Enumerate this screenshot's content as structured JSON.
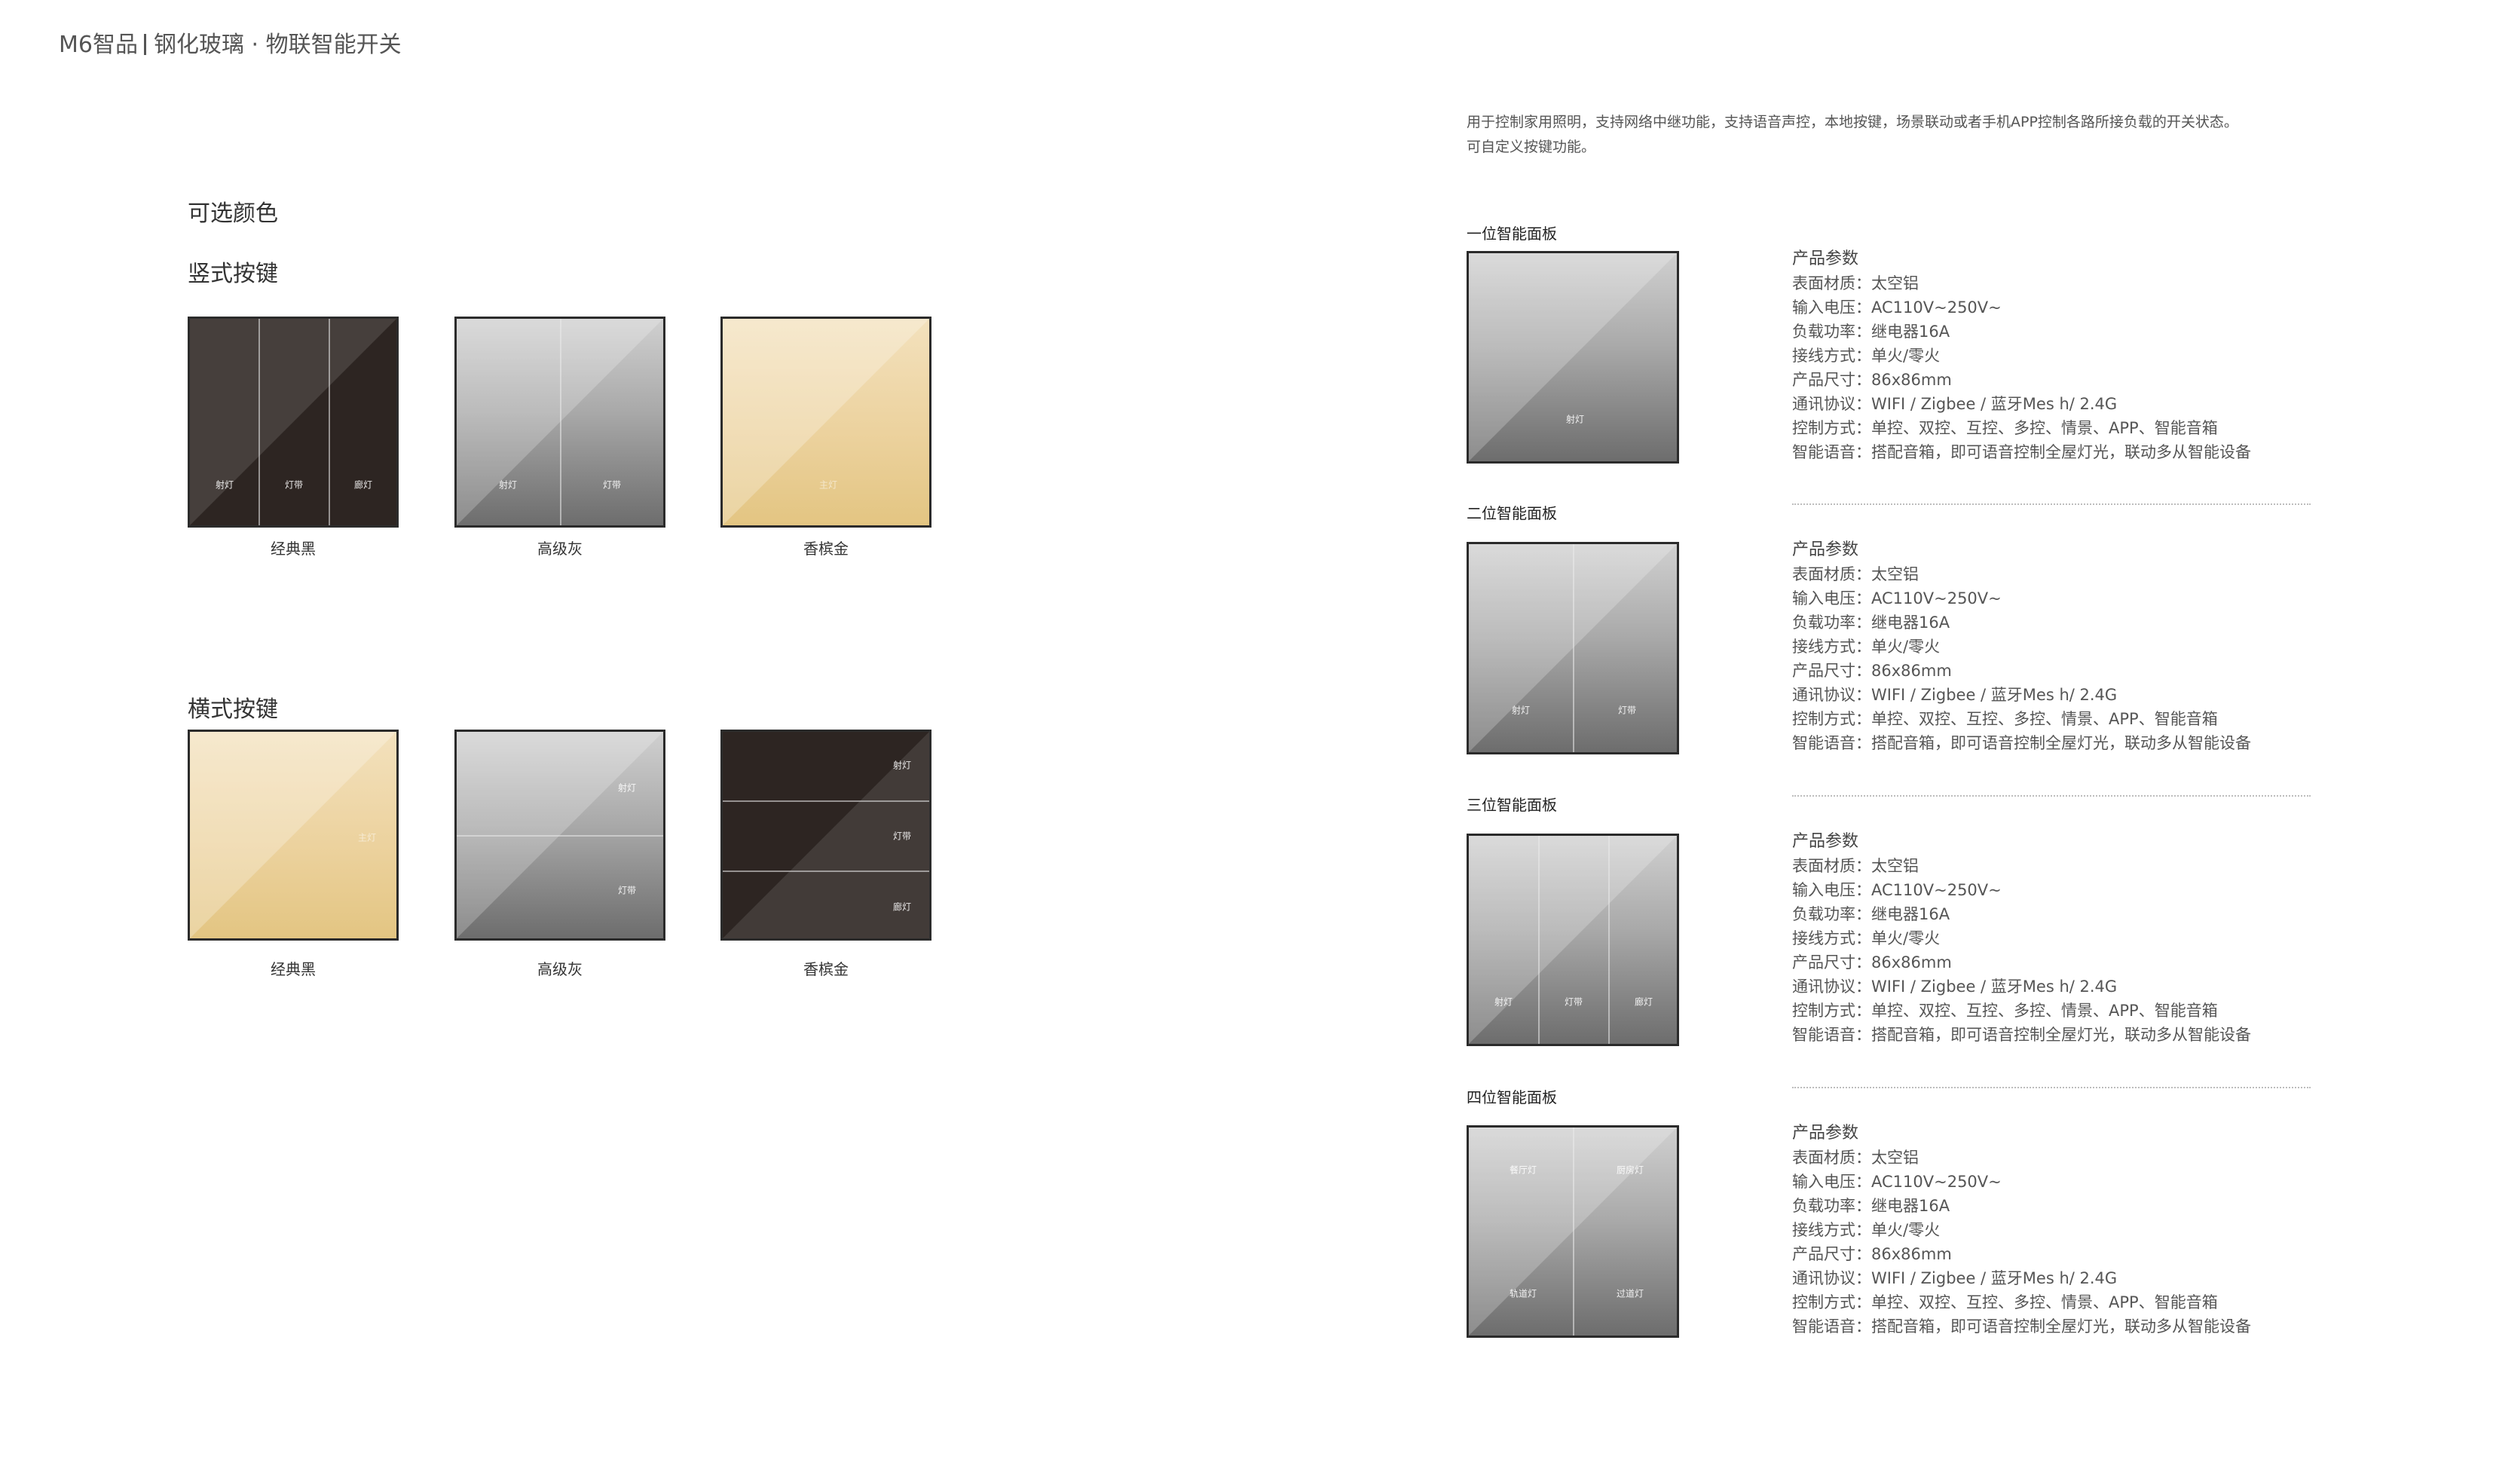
{
  "header": {
    "brand": "M6智品",
    "title": "钢化玻璃 · 物联智能开关"
  },
  "left": {
    "colors_title": "可选颜色",
    "vertical_title": "竖式按键",
    "horizontal_title": "横式按键",
    "vertical_panels": [
      {
        "color": "#2d2522",
        "labels": [
          "射灯",
          "灯带",
          "廊灯"
        ],
        "caption": "经典黑"
      },
      {
        "color": "#9b9b9b",
        "labels": [
          "射灯",
          "灯带"
        ],
        "caption": "高级灰"
      },
      {
        "color": "#ecd29e",
        "labels": [
          "主灯"
        ],
        "caption": "香槟金"
      }
    ],
    "horizontal_panels": [
      {
        "color": "#ecd29e",
        "labels": [
          "主灯"
        ],
        "caption": "经典黑"
      },
      {
        "color": "#9b9b9b",
        "labels": [
          "射灯",
          "灯带"
        ],
        "caption": "高级灰"
      },
      {
        "color": "#2d2522",
        "labels": [
          "射灯",
          "灯带",
          "廊灯"
        ],
        "caption": "香槟金"
      }
    ]
  },
  "right": {
    "intro_line1": "用于控制家用照明，支持网络中继功能，支持语音声控，本地按键，场景联动或者手机APP控制各路所接负载的开关状态。",
    "intro_line2": "可自定义按键功能。",
    "products": [
      {
        "name": "一位智能面板",
        "labels": [
          "射灯"
        ],
        "specs_title": "产品参数",
        "specs": [
          {
            "k": "表面材质：",
            "v": "太空铝"
          },
          {
            "k": "输入电压：",
            "v": "AC110V~250V~"
          },
          {
            "k": "负载功率：",
            "v": "继电器16A"
          },
          {
            "k": "接线方式：",
            "v": "单火/零火"
          },
          {
            "k": "产品尺寸：",
            "v": "86x86mm"
          },
          {
            "k": "通讯协议：",
            "v": "WIFI / Zigbee / 蓝牙Mes h/ 2.4G"
          },
          {
            "k": "控制方式：",
            "v": "单控、双控、互控、多控、情景、APP、智能音箱"
          },
          {
            "k": "智能语音：",
            "v": "搭配音箱，即可语音控制全屋灯光，联动多从智能设备"
          }
        ]
      },
      {
        "name": "二位智能面板",
        "labels": [
          "射灯",
          "灯带"
        ],
        "specs_title": "产品参数",
        "specs": [
          {
            "k": "表面材质：",
            "v": "太空铝"
          },
          {
            "k": "输入电压：",
            "v": "AC110V~250V~"
          },
          {
            "k": "负载功率：",
            "v": "继电器16A"
          },
          {
            "k": "接线方式：",
            "v": "单火/零火"
          },
          {
            "k": "产品尺寸：",
            "v": "86x86mm"
          },
          {
            "k": "通讯协议：",
            "v": "WIFI / Zigbee / 蓝牙Mes h/ 2.4G"
          },
          {
            "k": "控制方式：",
            "v": "单控、双控、互控、多控、情景、APP、智能音箱"
          },
          {
            "k": "智能语音：",
            "v": "搭配音箱，即可语音控制全屋灯光，联动多从智能设备"
          }
        ]
      },
      {
        "name": "三位智能面板",
        "labels": [
          "射灯",
          "灯带",
          "廊灯"
        ],
        "specs_title": "产品参数",
        "specs": [
          {
            "k": "表面材质：",
            "v": "太空铝"
          },
          {
            "k": "输入电压：",
            "v": "AC110V~250V~"
          },
          {
            "k": "负载功率：",
            "v": "继电器16A"
          },
          {
            "k": "接线方式：",
            "v": "单火/零火"
          },
          {
            "k": "产品尺寸：",
            "v": "86x86mm"
          },
          {
            "k": "通讯协议：",
            "v": "WIFI / Zigbee / 蓝牙Mes h/ 2.4G"
          },
          {
            "k": "控制方式：",
            "v": "单控、双控、互控、多控、情景、APP、智能音箱"
          },
          {
            "k": "智能语音：",
            "v": "搭配音箱，即可语音控制全屋灯光，联动多从智能设备"
          }
        ]
      },
      {
        "name": "四位智能面板",
        "labels": [
          "餐厅灯",
          "厨房灯",
          "轨道灯",
          "过道灯"
        ],
        "specs_title": "产品参数",
        "specs": [
          {
            "k": "表面材质：",
            "v": "太空铝"
          },
          {
            "k": "输入电压：",
            "v": "AC110V~250V~"
          },
          {
            "k": "负载功率：",
            "v": "继电器16A"
          },
          {
            "k": "接线方式：",
            "v": "单火/零火"
          },
          {
            "k": "产品尺寸：",
            "v": "86x86mm"
          },
          {
            "k": "通讯协议：",
            "v": "WIFI / Zigbee / 蓝牙Mes h/ 2.4G"
          },
          {
            "k": "控制方式：",
            "v": "单控、双控、互控、多控、情景、APP、智能音箱"
          },
          {
            "k": "智能语音：",
            "v": "搭配音箱，即可语音控制全屋灯光，联动多从智能设备"
          }
        ]
      }
    ]
  }
}
